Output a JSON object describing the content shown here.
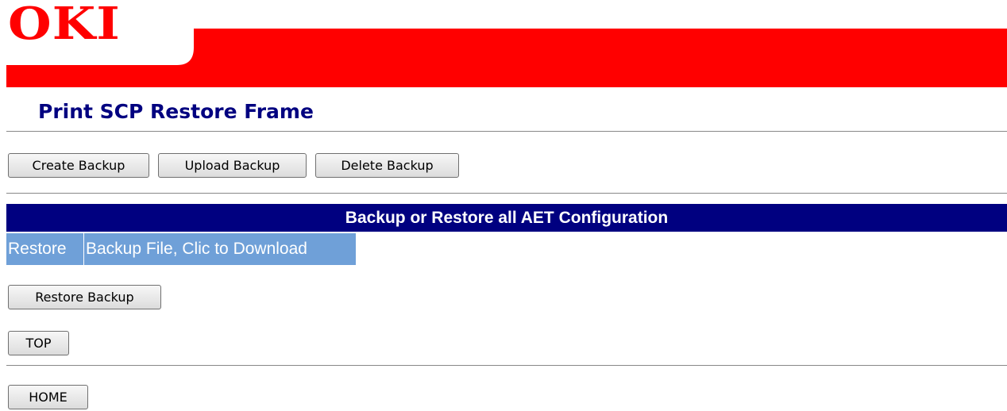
{
  "header": {
    "logo_text": "OKI",
    "brand_color": "#ff0000"
  },
  "page": {
    "title": "Print SCP Restore Frame"
  },
  "toolbar": {
    "create_label": "Create Backup",
    "upload_label": "Upload Backup",
    "delete_label": "Delete Backup"
  },
  "section": {
    "header": "Backup or Restore all AET Configuration",
    "header_color": "#000080",
    "columns": [
      "Restore",
      "Backup File, Clic to Download"
    ],
    "columns_color": "#6fa0d8"
  },
  "actions": {
    "restore_label": "Restore Backup",
    "top_label": "TOP",
    "home_label": "HOME"
  }
}
